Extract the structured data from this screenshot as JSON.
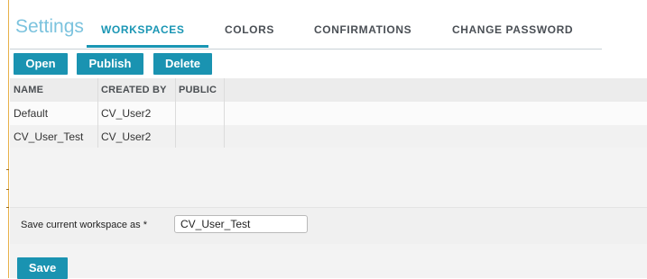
{
  "header": {
    "title": "Settings",
    "tabs": [
      {
        "label": "WORKSPACES",
        "active": true
      },
      {
        "label": "COLORS",
        "active": false
      },
      {
        "label": "CONFIRMATIONS",
        "active": false
      },
      {
        "label": "CHANGE PASSWORD",
        "active": false
      }
    ]
  },
  "toolbar": {
    "open_label": "Open",
    "publish_label": "Publish",
    "delete_label": "Delete"
  },
  "table": {
    "columns": [
      "NAME",
      "CREATED BY",
      "PUBLIC"
    ],
    "rows": [
      {
        "name": "Default",
        "created_by": "CV_User2",
        "public": ""
      },
      {
        "name": "CV_User_Test",
        "created_by": "CV_User2",
        "public": ""
      }
    ]
  },
  "save_form": {
    "label": "Save current workspace as *",
    "value": "CV_User_Test",
    "save_label": "Save"
  },
  "colors": {
    "accent": "#1a93b1",
    "title": "#7cc3de",
    "edge": "#e8b14a"
  }
}
